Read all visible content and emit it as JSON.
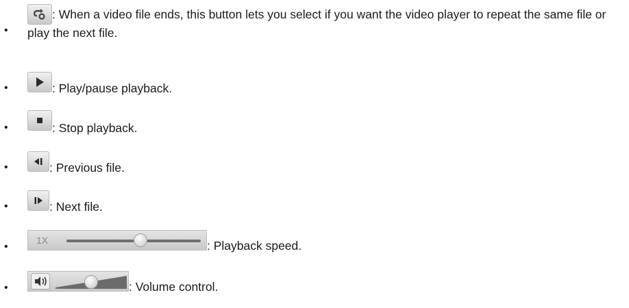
{
  "items": [
    {
      "icon": "repeat-icon",
      "text": ": When a video file ends, this button lets you select if you want the video player to repeat the same file or play the next file."
    },
    {
      "icon": "play-icon",
      "text": ": Play/pause playback."
    },
    {
      "icon": "stop-icon",
      "text": ": Stop playback."
    },
    {
      "icon": "previous-file-icon",
      "text": ": Previous file."
    },
    {
      "icon": "next-file-icon",
      "text": ": Next file."
    },
    {
      "icon": "speed-slider",
      "speed_label": "1X",
      "speed_level": 0.55,
      "text": ": Playback speed."
    },
    {
      "icon": "volume-icon",
      "volume_level": 0.5,
      "text": ": Volume control."
    }
  ],
  "bullet": "•"
}
